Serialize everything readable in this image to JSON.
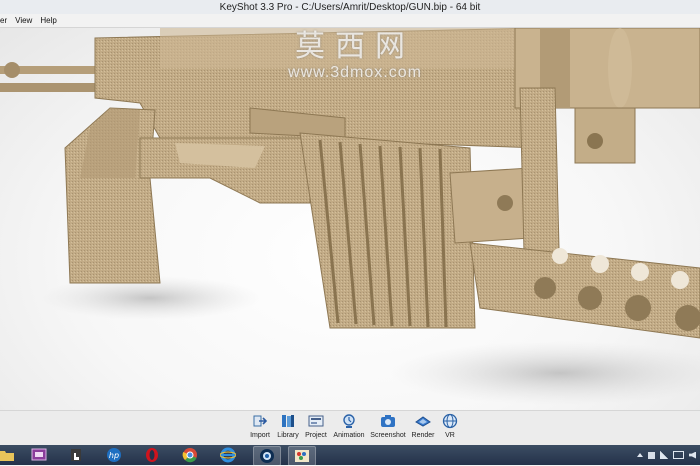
{
  "window": {
    "title": "KeyShot 3.3 Pro - C:/Users/Amrit/Desktop/GUN.bip - 64 bit"
  },
  "menu": {
    "items": [
      "er",
      "View",
      "Help"
    ]
  },
  "watermark": {
    "chinese": "莫西网",
    "url": "www.3dmox.com"
  },
  "ribbon": {
    "buttons": [
      {
        "label": "Import",
        "icon": "import-icon"
      },
      {
        "label": "Library",
        "icon": "library-icon"
      },
      {
        "label": "Project",
        "icon": "project-icon"
      },
      {
        "label": "Animation",
        "icon": "animation-icon"
      },
      {
        "label": "Screenshot",
        "icon": "screenshot-icon"
      },
      {
        "label": "Render",
        "icon": "render-icon"
      },
      {
        "label": "VR",
        "icon": "vr-icon"
      }
    ]
  },
  "taskbar": {
    "apps": [
      {
        "icon": "folder-icon"
      },
      {
        "icon": "media-icon"
      },
      {
        "icon": "touch-icon"
      },
      {
        "icon": "hp-icon"
      },
      {
        "icon": "opera-icon"
      },
      {
        "icon": "chrome-icon"
      },
      {
        "icon": "internet-explorer-icon"
      },
      {
        "icon": "keyshot-icon"
      },
      {
        "icon": "paint-icon"
      }
    ],
    "tray": [
      "chevron-up-icon",
      "flag-icon",
      "signal-icon",
      "battery-icon",
      "volume-icon"
    ]
  },
  "colors": {
    "model": "#c2ab86",
    "model_shadow": "#9d8662",
    "background": "#f4f4f4",
    "taskbar": "#2c3b52"
  }
}
